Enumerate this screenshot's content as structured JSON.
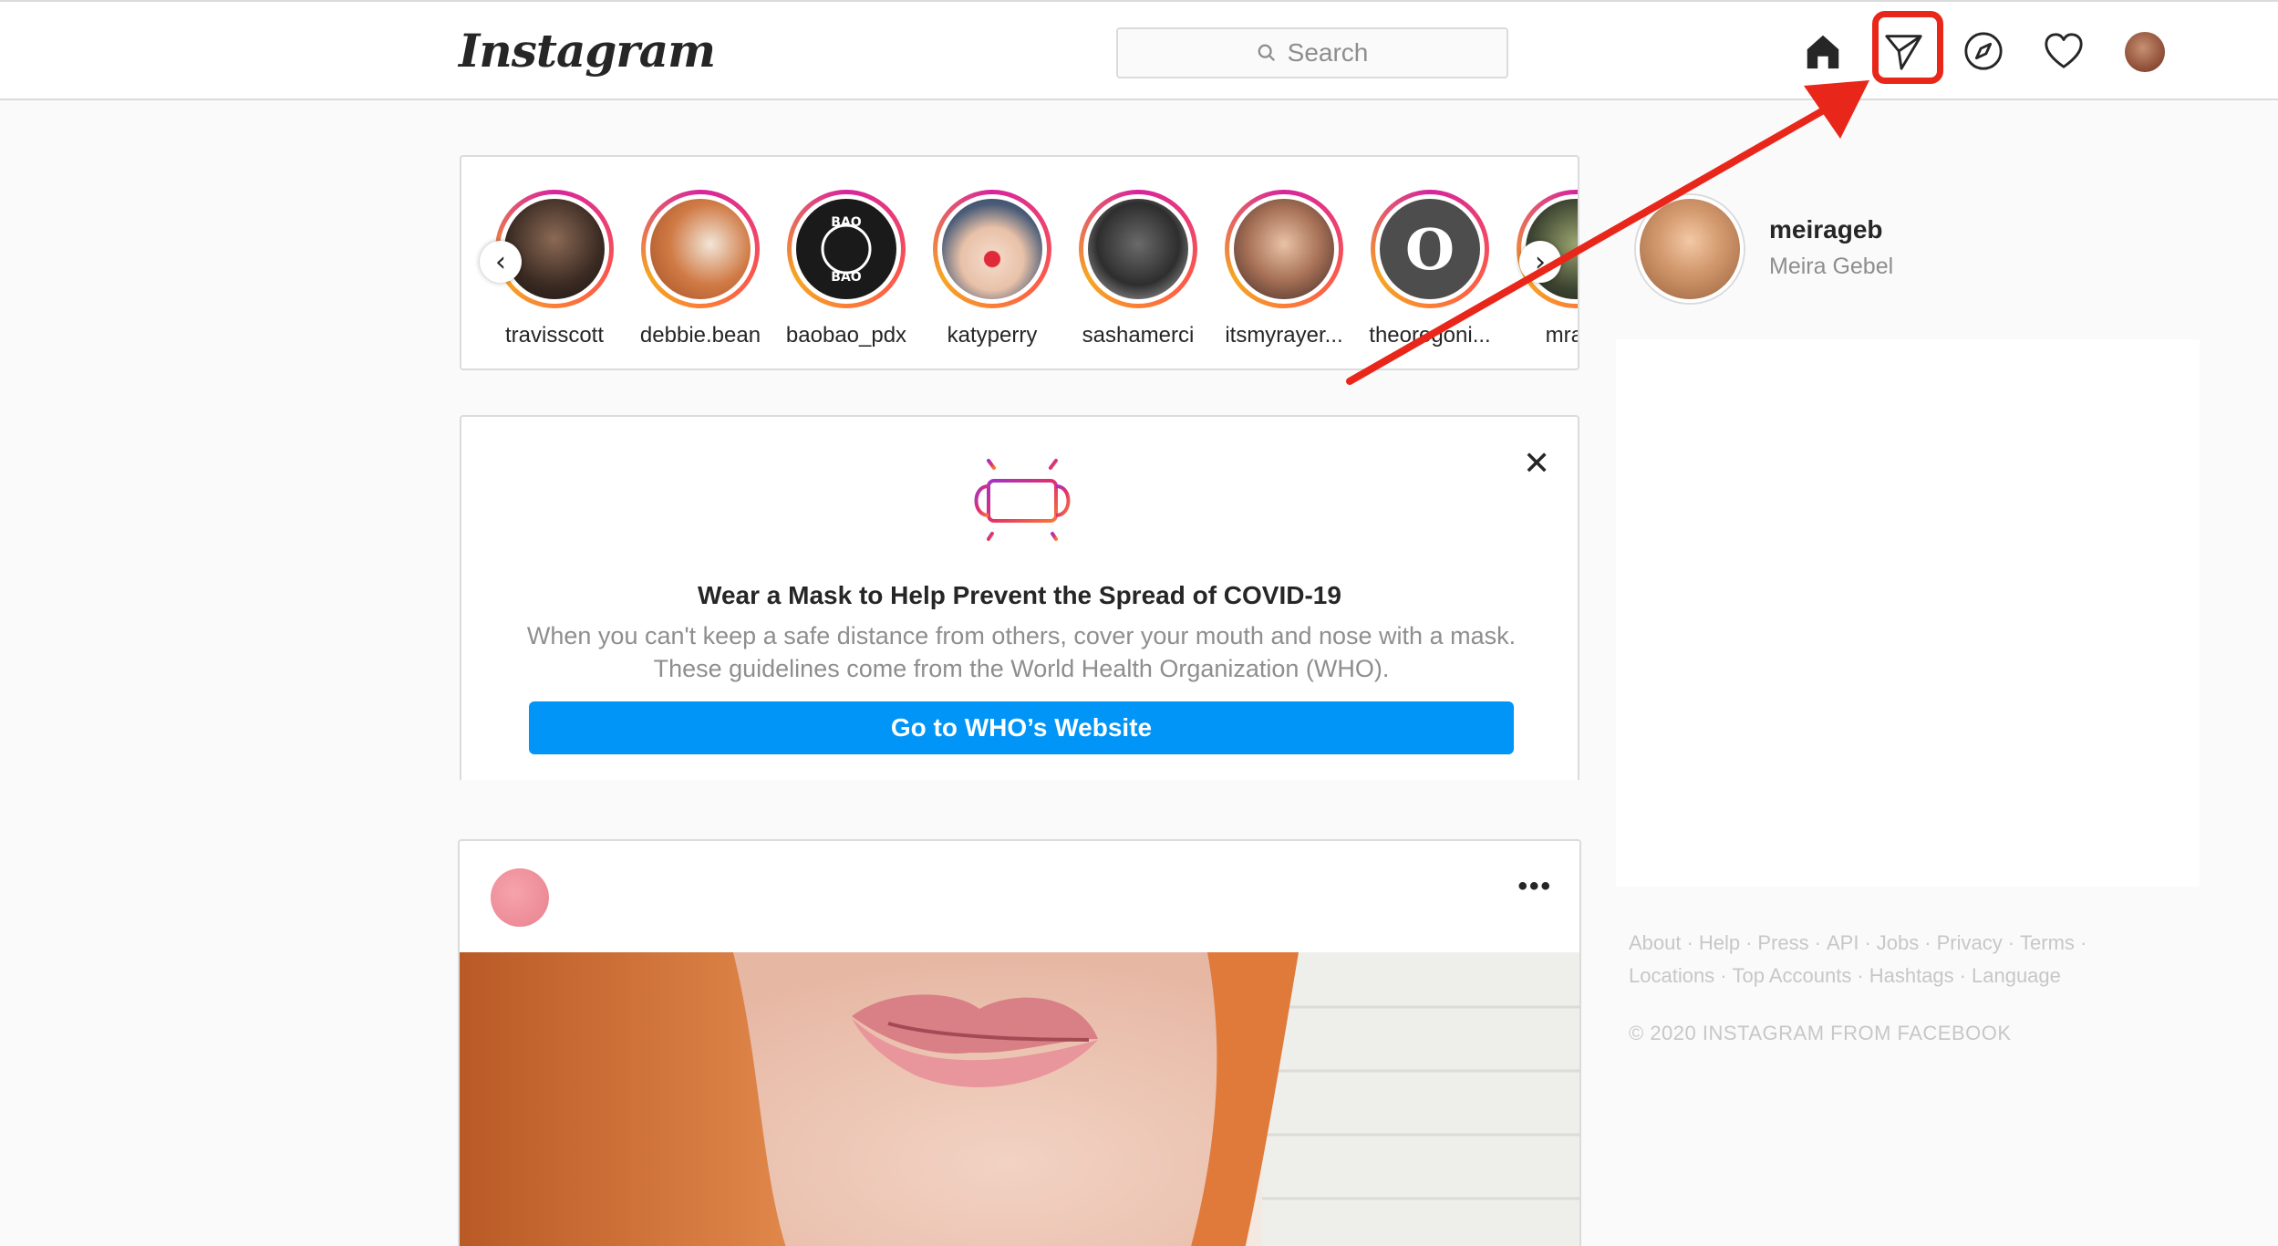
{
  "header": {
    "logo": "Instagram",
    "search_placeholder": "Search"
  },
  "nav_icons": [
    "home-icon",
    "direct-message-icon",
    "explore-compass-icon",
    "activity-heart-icon",
    "profile-avatar"
  ],
  "stories": [
    {
      "username": "travisscott"
    },
    {
      "username": "debbie.bean"
    },
    {
      "username": "baobao_pdx"
    },
    {
      "username": "katyperry"
    },
    {
      "username": "sashamerci"
    },
    {
      "username": "itsmyrayer..."
    },
    {
      "username": "theoregoni..."
    },
    {
      "username": "mrami"
    }
  ],
  "covid_card": {
    "title": "Wear a Mask to Help Prevent the Spread of COVID-19",
    "body": "When you can't keep a safe distance from others, cover your mouth and nose with a mask. These guidelines come from the World Health Organization (WHO).",
    "button_label": "Go to WHO’s Website"
  },
  "post": {
    "more_label": "•••"
  },
  "sidebar": {
    "username": "meirageb",
    "full_name": "Meira Gebel"
  },
  "footer": {
    "links": [
      "About",
      "Help",
      "Press",
      "API",
      "Jobs",
      "Privacy",
      "Terms",
      "Locations",
      "Top Accounts",
      "Hashtags",
      "Language"
    ],
    "copyright": "© 2020 INSTAGRAM FROM FACEBOOK"
  },
  "colors": {
    "accent_blue": "#0095f6",
    "annotation_red": "#e8271a",
    "story_ring": "#d6249f"
  }
}
